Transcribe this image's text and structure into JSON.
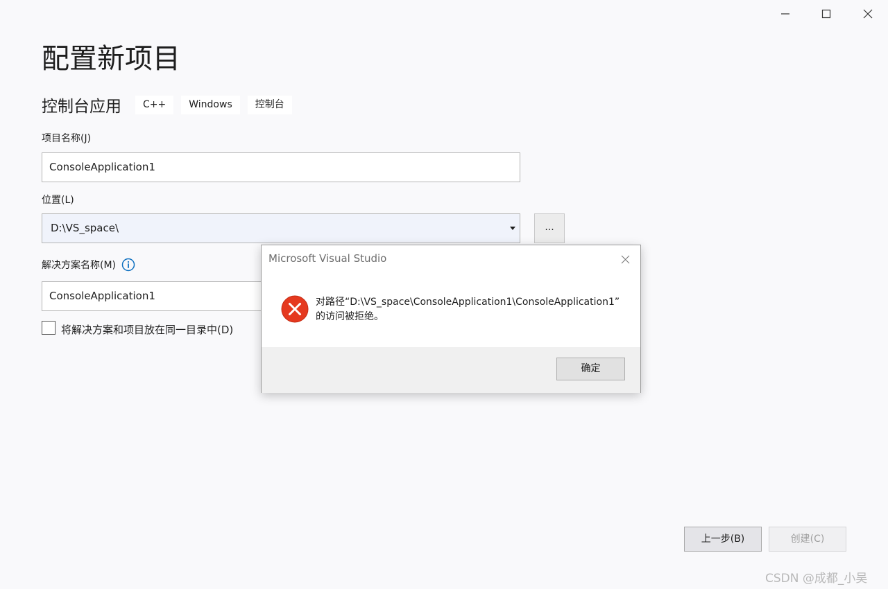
{
  "window": {
    "minimize_icon": "minimize-icon",
    "maximize_icon": "maximize-icon",
    "close_icon": "close-icon"
  },
  "page": {
    "title": "配置新项目",
    "template_name": "控制台应用",
    "tags": [
      "C++",
      "Windows",
      "控制台"
    ]
  },
  "form": {
    "project_name_label": "项目名称(J)",
    "project_name_value": "ConsoleApplication1",
    "location_label": "位置(L)",
    "location_value": "D:\\VS_space\\",
    "browse_label": "...",
    "solution_name_label": "解决方案名称(M)",
    "solution_name_value": "ConsoleApplication1",
    "same_dir_label": "将解决方案和项目放在同一目录中(D)",
    "same_dir_checked": false
  },
  "footer": {
    "back_label": "上一步(B)",
    "create_label": "创建(C)"
  },
  "dialog": {
    "title": "Microsoft Visual Studio",
    "message_line1": "对路径“D:\\VS_space\\ConsoleApplication1\\ConsoleApplication1”",
    "message_line2": "的访问被拒绝。",
    "ok_label": "确定",
    "icon": "error-icon",
    "icon_color": "#e5391f"
  },
  "watermark": "CSDN @成都_小吴",
  "colors": {
    "accent": "#0e70c0",
    "error": "#e5391f"
  }
}
